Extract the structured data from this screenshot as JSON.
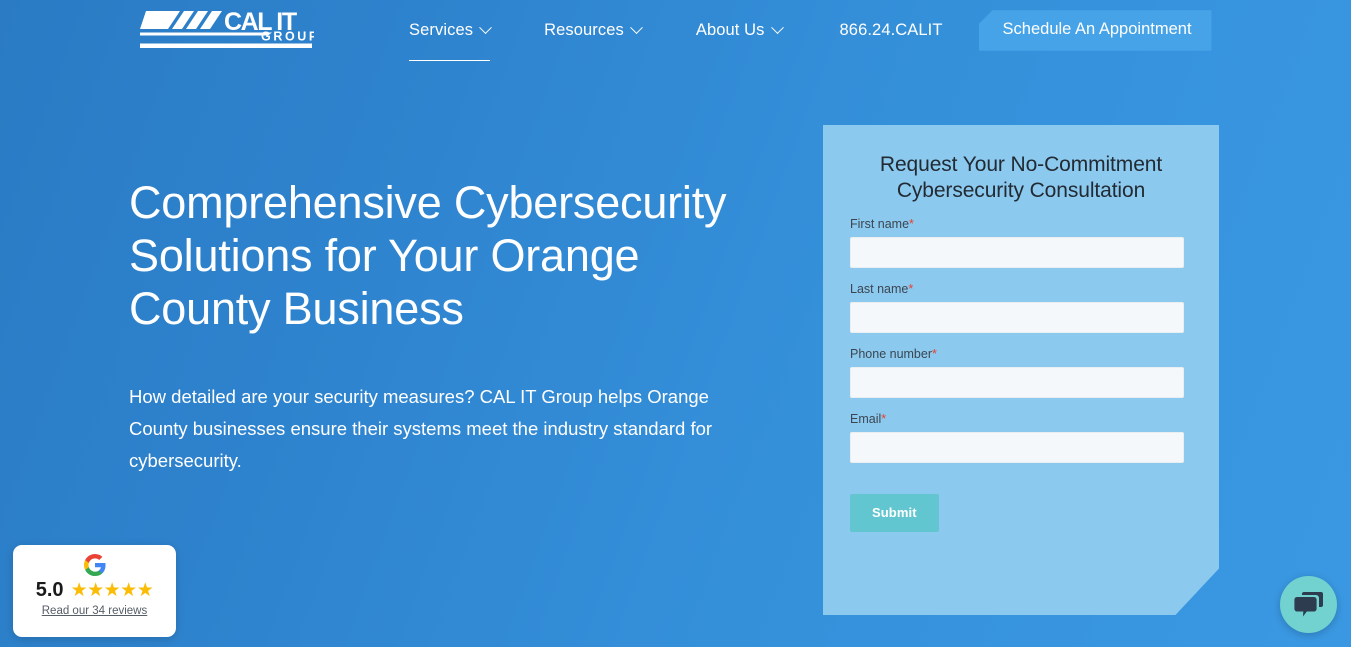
{
  "brand": {
    "logo_text_main": "CAL IT",
    "logo_text_sub": "GROUP",
    "accent_blue": "#46a3e8",
    "card_blue": "#8cc9ef",
    "submit_teal": "#62c6d0",
    "chat_teal": "#71d2cf",
    "required_red": "#e8422e",
    "star_gold": "#fbbc05",
    "bg_gradient_from": "#2a7bc4",
    "bg_gradient_to": "#3a98e2"
  },
  "header": {
    "nav": [
      {
        "label": "Services",
        "icon": "chevron-down-icon",
        "active": true
      },
      {
        "label": "Resources",
        "icon": "chevron-down-icon",
        "active": false
      },
      {
        "label": "About Us",
        "icon": "chevron-down-icon",
        "active": false
      }
    ],
    "phone": "866.24.CALIT",
    "cta_label": "Schedule An Appointment"
  },
  "hero": {
    "title": "Comprehensive Cybersecurity Solutions for Your Orange County Business",
    "subtitle": "How detailed are your security measures? CAL IT Group helps Orange County businesses ensure their systems meet the industry standard for cybersecurity."
  },
  "form": {
    "title": "Request Your No-Commitment Cybersecurity Consultation",
    "fields": [
      {
        "label": "First name",
        "required_mark": "*",
        "value": "",
        "placeholder": ""
      },
      {
        "label": "Last name",
        "required_mark": "*",
        "value": "",
        "placeholder": ""
      },
      {
        "label": "Phone number",
        "required_mark": "*",
        "value": "",
        "placeholder": ""
      },
      {
        "label": "Email",
        "required_mark": "*",
        "value": "",
        "placeholder": ""
      }
    ],
    "submit_label": "Submit"
  },
  "review_badge": {
    "logo": "google-logo-icon",
    "rating": "5.0",
    "stars": "★★★★★",
    "link_text": "Read our 34 reviews"
  },
  "chat": {
    "icon": "chat-bubbles-icon"
  }
}
